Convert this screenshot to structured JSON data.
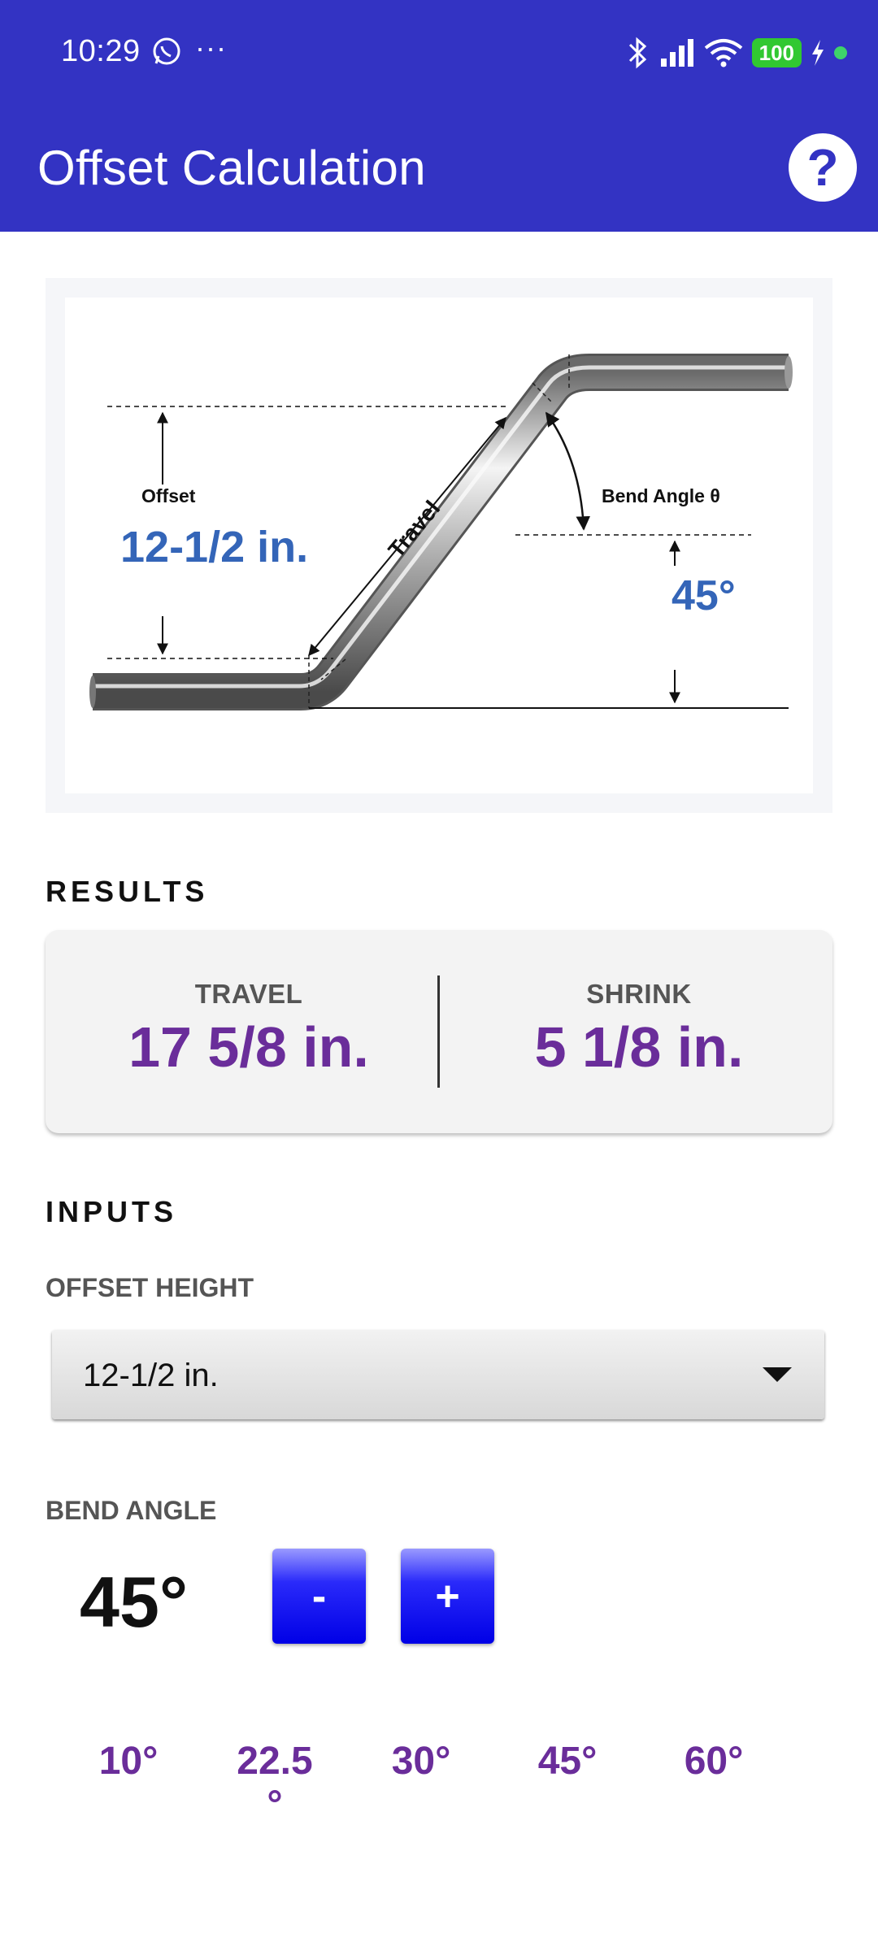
{
  "status_bar": {
    "time": "10:29",
    "dots": "···",
    "battery": "100"
  },
  "app_bar": {
    "title": "Offset Calculation",
    "help_label": "?"
  },
  "diagram": {
    "offset_label": "Offset",
    "offset_value": "12-1/2 in.",
    "travel_label": "Travel",
    "bend_angle_label": "Bend Angle θ",
    "angle_value": "45°"
  },
  "results": {
    "heading": "RESULTS",
    "travel_label": "TRAVEL",
    "travel_value": "17 5/8 in.",
    "shrink_label": "SHRINK",
    "shrink_value": "5 1/8 in."
  },
  "inputs": {
    "heading": "INPUTS",
    "offset_height_label": "OFFSET HEIGHT",
    "offset_height_value": "12-1/2 in.",
    "bend_angle_label": "BEND ANGLE",
    "bend_angle_value": "45°",
    "minus_label": "-",
    "plus_label": "+",
    "presets": [
      "10°",
      "22.5\n°",
      "30°",
      "45°",
      "60°"
    ]
  },
  "colors": {
    "primary": "#3333c3",
    "accent_purple": "#6a2d9a",
    "diagram_blue": "#3465b8",
    "button_blue": "#0000e6"
  }
}
